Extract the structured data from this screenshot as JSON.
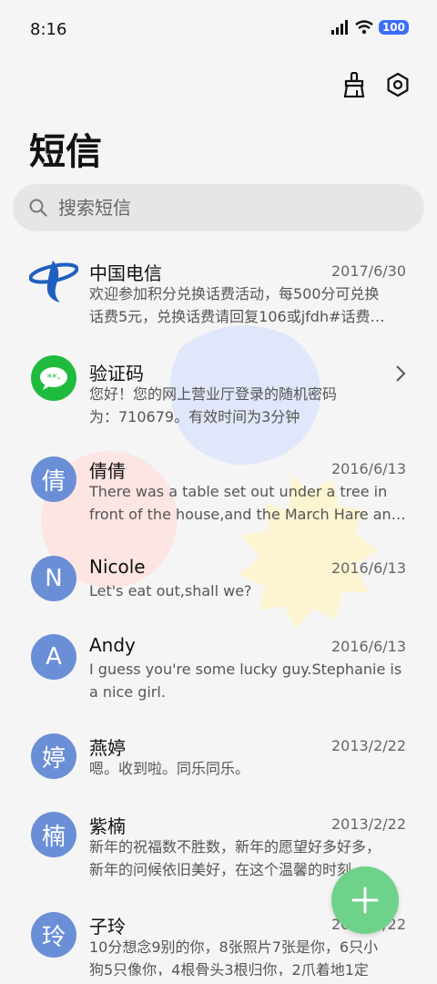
{
  "status": {
    "time": "8:16",
    "battery": "100"
  },
  "title": "短信",
  "search": {
    "placeholder": "搜索短信"
  },
  "messages": [
    {
      "sender": "中国电信",
      "date": "2017/6/30",
      "line1": "欢迎参加积分兑换话费活动，每500分可兑换",
      "line2": "话费5元，兑换话费请回复106或jfdh#话费…"
    },
    {
      "sender": "验证码",
      "date": "",
      "line1": "您好！您的网上营业厅登录的随机密码",
      "line2": "为：710679。有效时间为3分钟",
      "avatar_text": "**-"
    },
    {
      "sender": "倩倩",
      "date": "2016/6/13",
      "line1": "There was a table set out under a tree in",
      "line2": "front of the house,and the March Hare an…",
      "avatar_text": "倩"
    },
    {
      "sender": "Nicole",
      "date": "2016/6/13",
      "line1": "Let's eat out,shall we?",
      "line2": "",
      "avatar_text": "N"
    },
    {
      "sender": "Andy",
      "date": "2016/6/13",
      "line1": "I guess you're some lucky guy.Stephanie is",
      "line2": "a nice girl.",
      "avatar_text": "A"
    },
    {
      "sender": "燕婷",
      "date": "2013/2/22",
      "line1": "嗯。收到啦。同乐同乐。",
      "line2": "",
      "avatar_text": "婷"
    },
    {
      "sender": "紫楠",
      "date": "2013/2/22",
      "line1": "新年的祝福数不胜数，新年的愿望好多好多，",
      "line2": "新年的问候依旧美好，在这个温馨的时刻…",
      "avatar_text": "楠"
    },
    {
      "sender": "子玲",
      "date": "2013/2/22",
      "line1": "10分想念9别的你，8张照片7张是你，6只小",
      "line2": "狗5只像你，4根骨头3根归你，2爪着地1定",
      "avatar_text": "玲"
    }
  ],
  "colors": {
    "avatar": "#6b8fd6",
    "fab": "#6fd28a",
    "telecom": "#1f5fbf",
    "verify": "#1fbb3e"
  }
}
